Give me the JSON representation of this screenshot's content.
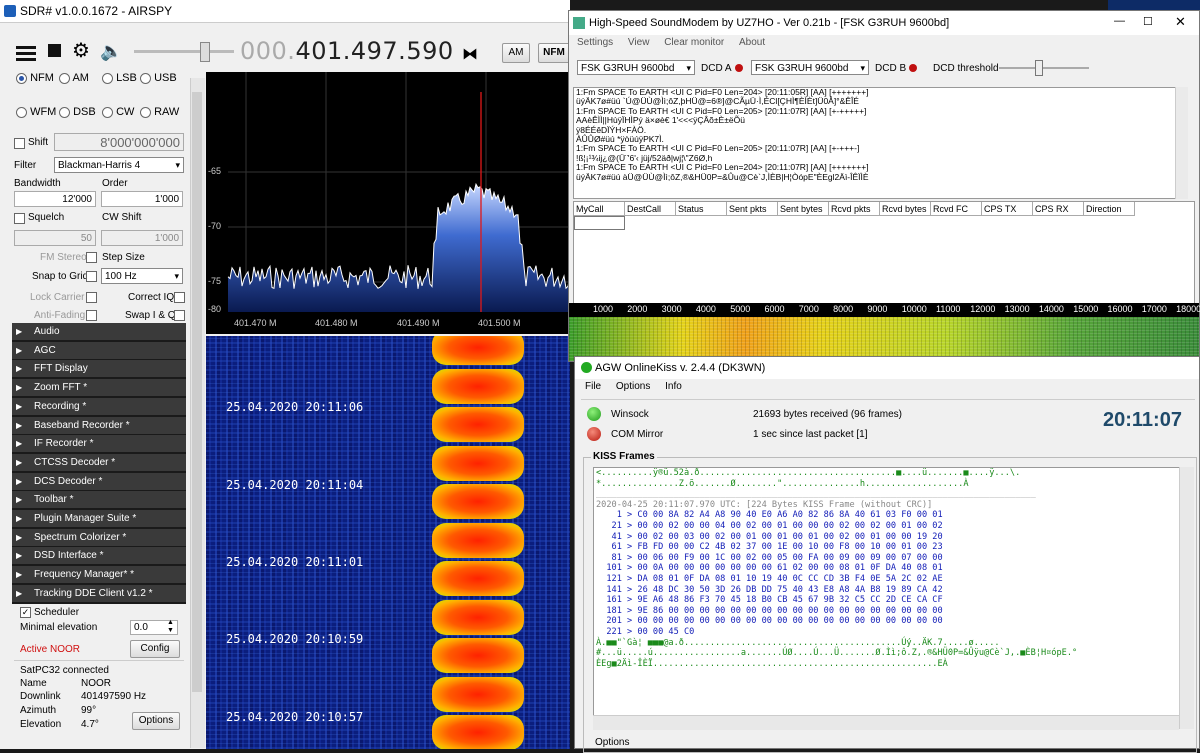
{
  "sdr": {
    "title": "SDR# v1.0.0.1672 - AIRSPY",
    "freq_prefix": "000.",
    "freq_main": "401.497.590",
    "modes_row1": [
      "NFM",
      "AM",
      "LSB",
      "USB"
    ],
    "modes_row2": [
      "WFM",
      "DSB",
      "CW",
      "RAW"
    ],
    "selected_mode": "NFM",
    "toolbar_btn_am": "AM",
    "toolbar_btn_nfm": "NFM",
    "shift_label": "Shift",
    "shift_value": "8'000'000'000",
    "filter_label": "Filter",
    "filter_value": "Blackman-Harris 4",
    "bandwidth_label": "Bandwidth",
    "bandwidth_value": "12'000",
    "order_label": "Order",
    "order_value": "1'000",
    "squelch_label": "Squelch",
    "cwshift_label": "CW Shift",
    "squelch_value": "50",
    "cwshift_value": "1'000",
    "fm_stereo_label": "FM Stereo",
    "step_size_label": "Step Size",
    "snap_label": "Snap to Grid",
    "step_value": "100 Hz",
    "lock_carrier_label": "Lock Carrier",
    "correct_iq_label": "Correct IQ",
    "anti_fading_label": "Anti-Fading",
    "swap_iq_label": "Swap I & Q",
    "plugins": [
      "Audio",
      "AGC",
      "FFT Display",
      "Zoom FFT *",
      "Recording *",
      "Baseband Recorder *",
      "IF Recorder *",
      "CTCSS Decoder *",
      "DCS Decoder *",
      "Toolbar *",
      "Plugin Manager Suite *",
      "Spectrum Colorizer *",
      "DSD Interface *",
      "Frequency Manager* *",
      "Tracking DDE Client v1.2 *"
    ],
    "scheduler_label": "Scheduler",
    "min_elev_label": "Minimal elevation",
    "min_elev_value": "0.0",
    "active_label": "Active NOOR",
    "config_btn": "Config",
    "satpc_label": "SatPC32 connected",
    "info": [
      {
        "k": "Name",
        "v": "NOOR"
      },
      {
        "k": "Downlink",
        "v": "401497590 Hz"
      },
      {
        "k": "Azimuth",
        "v": "99°"
      },
      {
        "k": "Elevation",
        "v": "4.7°"
      }
    ],
    "options_btn": "Options",
    "spectrum": {
      "y_ticks": [
        "-65",
        "-70",
        "-75",
        "-80"
      ],
      "x_ticks": [
        "401.470 M",
        "401.480 M",
        "401.490 M",
        "401.500 M"
      ]
    },
    "waterfall_timestamps": [
      "25.04.2020 20:11:06",
      "25.04.2020 20:11:04",
      "25.04.2020 20:11:01",
      "25.04.2020 20:10:59",
      "25.04.2020 20:10:57"
    ]
  },
  "soundmodem": {
    "title": "High-Speed SoundModem by UZ7HO - Ver 0.21b - [FSK G3RUH 9600bd]",
    "menu": [
      "Settings",
      "View",
      "Clear monitor",
      "About"
    ],
    "modem_a": "FSK G3RUH 9600bd",
    "dcd_a": "DCD A",
    "modem_b": "FSK G3RUH 9600bd",
    "dcd_b": "DCD B",
    "dcd_threshold": "DCD threshold",
    "log": [
      "1:Fm SPACE To EARTH <UI C Pid=F0 Len=204> [20:11:05R] [AA] [+++++++]",
      "üýÄK7ø#üú                    `Ú@ÜÙ@Ìì;ôZ,þHÜ@=6®]@CÃµÜ·Ì,ÉCl[ÇHÌ¶ÈÌÈt]Ü0Å]°&ÊÎÉ",
      "1:Fm SPACE To EARTH <UI C Pid=F0 Len=205> [20:11:07R] [AA] [+-+++++]",
      "AAèÊÌÌ||HùÿÏHÌPý ä×øè€          1'<<<ÿÇÂõ±È±ëÕü",
      "ÿ8ÉÉêDÏÝH×FÀÖ.",
      "ÀÛÛØ#üú                           *ÿòüúÿPK7Ì.",
      "1:Fm SPACE To EARTH <UI C Pid=F0 Len=205> [20:11:07R] [AA] [+-+++-]",
      "!ß¦¡¹¾ij¿@(Ü¨'6'‹ jüj/52äð|wj¦\\\"Z6Ø,h",
      "1:Fm SPACE To EARTH <UI C Pid=F0 Len=204> [20:11:07R] [AA] [+++++++]",
      "üýÄK7ø#üú                   àÜ@ÜÙ@Ìì;ôZ,®&HÜ0P=&Ûu@Cè`J,ÌÈB|H¦ÒópE\"ÈEgl2Äì-ÎÊÏÌÈ"
    ],
    "columns": [
      "MyCall",
      "DestCall",
      "Status",
      "Sent pkts",
      "Sent bytes",
      "Rcvd pkts",
      "Rcvd bytes",
      "Rcvd FC",
      "CPS TX",
      "CPS RX",
      "Direction"
    ],
    "scale": [
      "1000",
      "2000",
      "3000",
      "4000",
      "5000",
      "6000",
      "7000",
      "8000",
      "9000",
      "10000",
      "11000",
      "12000",
      "13000",
      "14000",
      "15000",
      "16000",
      "17000",
      "18000"
    ]
  },
  "agw": {
    "title": "AGW OnlineKiss v. 2.4.4  (DK3WN)",
    "menu": [
      "File",
      "Options",
      "Info"
    ],
    "winsock_label": "Winsock",
    "winsock_status": "21693 bytes received (96 frames)",
    "com_label": "COM Mirror",
    "com_status": "1 sec since last packet [1]",
    "clock": "20:11:07",
    "kiss_label": "KISS Frames",
    "options_label": "Options",
    "kiss_lines": [
      {
        "c": "txt",
        "t": "<..........ÿ®ü.52à.ð......................................■....ü.......■....ÿ...\\."
      },
      {
        "c": "txt",
        "t": "*...............Z.õ.......Ø........\"...............h...................À"
      },
      {
        "c": "sep",
        "t": "_____________________________________________________________________________________"
      },
      {
        "c": "hdr",
        "t": "2020-04-25 20:11:07.970 UTC: [224 Bytes KISS Frame (without CRC)]"
      },
      {
        "c": "hex",
        "t": "    1 > C0 00 8A 82 A4 A8 90 40 E0 A6 A0 82 86 8A 40 61 03 F0 00 01"
      },
      {
        "c": "hex",
        "t": "   21 > 00 00 02 00 00 04 00 02 00 01 00 00 00 02 00 02 00 01 00 02"
      },
      {
        "c": "hex",
        "t": "   41 > 00 02 00 03 00 02 00 01 00 01 00 01 00 02 00 01 00 00 19 20"
      },
      {
        "c": "hex",
        "t": "   61 > FB FD 00 00 C2 4B 02 37 00 1E 00 10 00 F8 00 10 00 01 00 23"
      },
      {
        "c": "hex",
        "t": "   81 > 00 06 00 F9 00 1C 00 02 00 05 00 FA 00 09 00 09 00 07 00 00"
      },
      {
        "c": "hex",
        "t": "  101 > 00 0A 00 00 00 00 00 00 00 61 02 00 00 08 01 0F DA 40 08 01"
      },
      {
        "c": "hex",
        "t": "  121 > DA 08 01 0F DA 08 01 10 19 40 0C CC CD 3B F4 0E 5A 2C 02 AE"
      },
      {
        "c": "hex",
        "t": "  141 > 26 48 DC 30 50 3D 26 DB DD 75 40 43 E8 A8 4A B8 19 89 CA 42"
      },
      {
        "c": "hex",
        "t": "  161 > 9E A6 48 86 F3 70 45 18 B0 CB 45 67 9B 32 C5 CC 2D CE CA CF"
      },
      {
        "c": "hex",
        "t": "  181 > 9E 86 00 00 00 00 00 00 00 00 00 00 00 00 00 00 00 00 00 00"
      },
      {
        "c": "hex",
        "t": "  201 > 00 00 00 00 00 00 00 00 00 00 00 00 00 00 00 00 00 00 00 00"
      },
      {
        "c": "hex",
        "t": "  221 > 00 00 45 C0"
      },
      {
        "c": "txt",
        "t": "À.■■\"`Gà¦ ■■■@a.ð..........................................Úý..ÄK.7.....ø....."
      },
      {
        "c": "txt",
        "t": "#...ü.....ú.................a.......ÚØ....Ú...Ü.......Ø.Ìì;ô.Z,.®&HÜ0P=&Ûÿu@Cè`J,.■ÈB¦H¤ópE.°"
      },
      {
        "c": "txt",
        "t": "ÈEg■2Äì-ÎÈÏ.......................................................EÀ"
      }
    ]
  }
}
